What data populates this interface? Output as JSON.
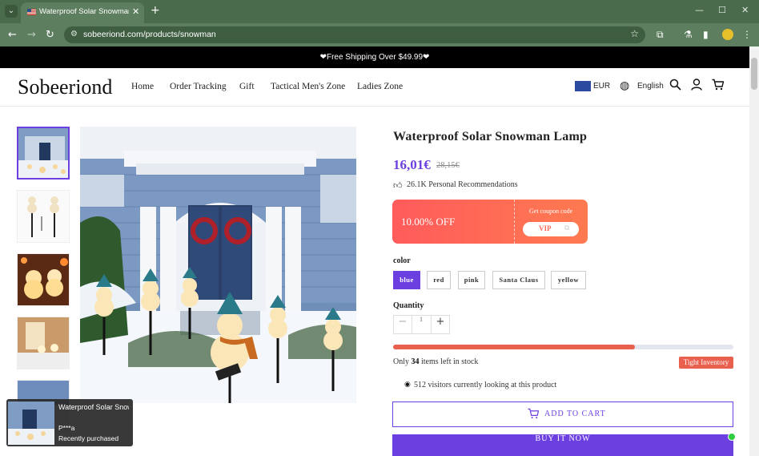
{
  "browser": {
    "tab_title": "Waterproof Solar Snowman Lamp",
    "tab_close": "✕",
    "new_tab": "+",
    "url": "sobeeriond.com/products/snowman",
    "win_min": "—",
    "win_max": "☐",
    "win_close": "✕"
  },
  "announcement": "❤Free Shipping Over $49.99❤",
  "header": {
    "logo": "Sobeeriond",
    "nav": [
      "Home",
      "Order Tracking",
      "Gift",
      "Tactical Men's Zone",
      "Ladies Zone"
    ],
    "currency": "EUR",
    "language": "English"
  },
  "product": {
    "title": "Waterproof Solar Snowman Lamp",
    "price": "16,01€",
    "old_price": "28,15€",
    "recommendations": "26.1K Personal Recommendations",
    "coupon": {
      "discount": "10.00% OFF",
      "get_label": "Get coupon code",
      "code": "VIP"
    },
    "color_label": "color",
    "colors": [
      "blue",
      "red",
      "pink",
      "Santa Claus",
      "yellow"
    ],
    "selected_color": "blue",
    "quantity_label": "Quantity",
    "quantity": "1",
    "stock": {
      "prefix": "Only",
      "count": "34",
      "suffix": "items left in stock",
      "level": 0.71,
      "badge": "Tight Inventory"
    },
    "visitors": "512 visitors currently looking at this product",
    "add_to_cart": "ADD TO CART",
    "buy_now": "BUY IT NOW"
  },
  "toast": {
    "title": "Waterproof Solar Snowman Lamp",
    "user": "P***a",
    "subtitle": "Recently purchased"
  },
  "colors": {
    "accent": "#6c3fe0",
    "coupon_start": "#ff5b5b",
    "stock_fill": "#e9604e",
    "chrome": "#4a6b4c"
  }
}
